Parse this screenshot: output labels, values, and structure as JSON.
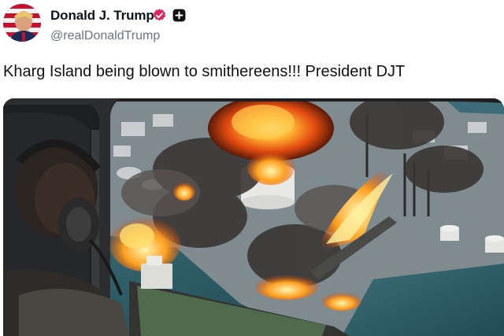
{
  "author": {
    "display_name": "Donald J. Trump",
    "handle": "@realDonaldTrump",
    "avatar_icon": "user-avatar",
    "badge_icon": "verified-badge-icon",
    "badge_color": "#e0245e",
    "extra_icon": "plus-box-icon"
  },
  "post": {
    "text": "Kharg Island being blown to smithereens!!! President DJT"
  },
  "media": {
    "kind": "image",
    "subject": "aerial-explosion-scene"
  }
}
